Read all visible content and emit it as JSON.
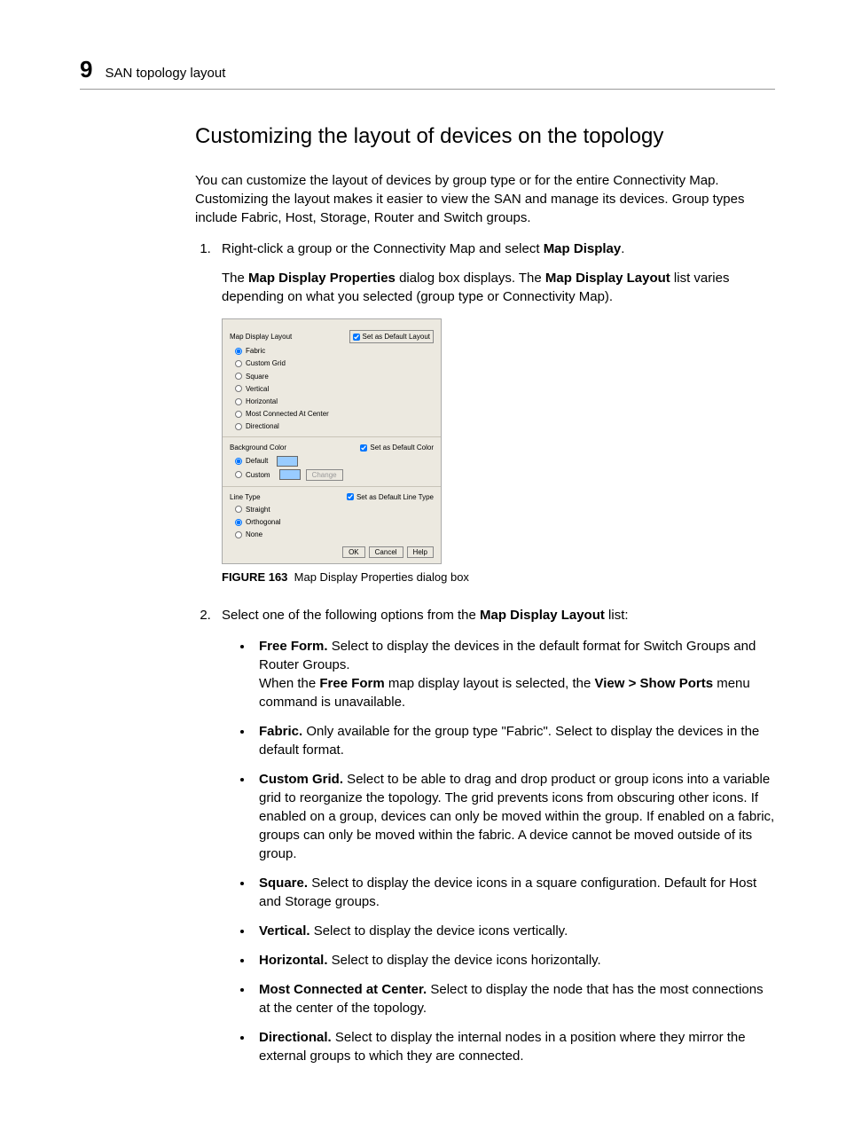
{
  "header": {
    "chapter_number": "9",
    "running_head": "SAN topology layout"
  },
  "title": "Customizing the layout of devices on the topology",
  "intro": "You can customize the layout of devices by group type or for the entire Connectivity Map. Customizing the layout makes it easier to view the SAN and manage its devices. Group types include Fabric, Host, Storage, Router and Switch groups.",
  "step1": {
    "prefix": "Right-click a group or the Connectivity Map and select ",
    "action": "Map Display",
    "suffix": ".",
    "result_a": "The ",
    "result_b": "Map Display Properties",
    "result_c": " dialog box displays. The ",
    "result_d": "Map Display Layout",
    "result_e": " list varies depending on what you selected (group type or Connectivity Map)."
  },
  "dialog": {
    "layout_label": "Map Display Layout",
    "set_default_layout": "Set as Default Layout",
    "layout_options": [
      "Fabric",
      "Custom Grid",
      "Square",
      "Vertical",
      "Horizontal",
      "Most Connected At Center",
      "Directional"
    ],
    "bg_label": "Background Color",
    "set_default_color": "Set as Default Color",
    "bg_options": [
      "Default",
      "Custom"
    ],
    "change_btn": "Change",
    "line_label": "Line Type",
    "set_default_line": "Set as Default Line Type",
    "line_options": [
      "Straight",
      "Orthogonal",
      "None"
    ],
    "buttons": {
      "ok": "OK",
      "cancel": "Cancel",
      "help": "Help"
    }
  },
  "figure": {
    "label": "FIGURE 163",
    "caption": "Map Display Properties dialog box"
  },
  "step2": {
    "prefix": "Select one of the following options from the ",
    "bold": "Map Display Layout",
    "suffix": " list:"
  },
  "options": {
    "free_form": {
      "name": "Free Form.",
      "text1": " Select to display the devices in the default format for Switch Groups and Router Groups.",
      "text2a": "When the ",
      "text2b": "Free Form",
      "text2c": " map display layout is selected, the ",
      "text2d": "View > Show Ports",
      "text2e": " menu command is unavailable."
    },
    "fabric": {
      "name": "Fabric.",
      "text": " Only available for the group type \"Fabric\". Select to display the devices in the default format."
    },
    "custom_grid": {
      "name": "Custom Grid.",
      "text": " Select to be able to drag and drop product or group icons into a variable grid to reorganize the topology. The grid prevents icons from obscuring other icons. If enabled on a group, devices can only be moved within the group. If enabled on a fabric, groups can only be moved within the fabric. A device cannot be moved outside of its group."
    },
    "square": {
      "name": "Square.",
      "text": " Select to display the device icons in a square configuration. Default for Host and Storage groups."
    },
    "vertical": {
      "name": "Vertical.",
      "text": " Select to display the device icons vertically."
    },
    "horizontal": {
      "name": "Horizontal.",
      "text": " Select to display the device icons horizontally."
    },
    "most_connected": {
      "name": "Most Connected at Center.",
      "text": " Select to display the node that has the most connections at the center of the topology."
    },
    "directional": {
      "name": "Directional.",
      "text": " Select to display the internal nodes in a position where they mirror the external groups to which they are connected."
    }
  }
}
